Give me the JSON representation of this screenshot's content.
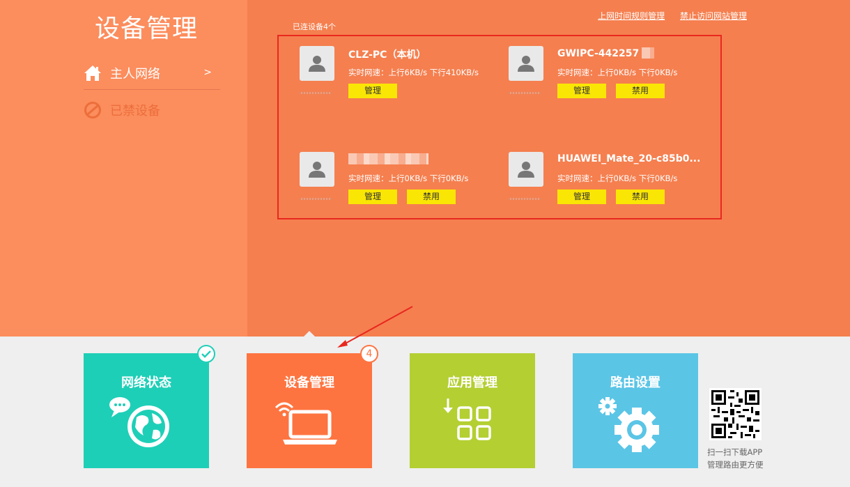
{
  "sidebar": {
    "title": "设备管理",
    "items": [
      {
        "label": "主人网络",
        "arrow": ">"
      },
      {
        "label": "已禁设备"
      }
    ]
  },
  "topbar": {
    "links": [
      "上网时间规则管理",
      "禁止访问网站管理"
    ]
  },
  "devices": {
    "count_label": "已连设备4个",
    "list": [
      {
        "name": "CLZ-PC（本机）",
        "speed": "实时网速：上行6KB/s 下行410KB/s",
        "buttons": [
          "管理"
        ]
      },
      {
        "name": "GWIPC-442257",
        "speed": "实时网速：上行0KB/s 下行0KB/s",
        "buttons": [
          "管理",
          "禁用"
        ]
      },
      {
        "name": "",
        "speed": "实时网速：上行0KB/s 下行0KB/s",
        "buttons": [
          "管理",
          "禁用"
        ]
      },
      {
        "name": "HUAWEI_Mate_20-c85b0...",
        "speed": "实时网速：上行0KB/s 下行0KB/s",
        "buttons": [
          "管理",
          "禁用"
        ]
      }
    ]
  },
  "tiles": [
    {
      "label": "网络状态",
      "color": "#1ecfb7",
      "icon": "globe-chat-icon",
      "badge": "check"
    },
    {
      "label": "设备管理",
      "color": "#fe7440",
      "icon": "laptop-wifi-icon",
      "badge": "4"
    },
    {
      "label": "应用管理",
      "color": "#b4cf32",
      "icon": "apps-grid-icon"
    },
    {
      "label": "路由设置",
      "color": "#5bc5e6",
      "icon": "gear-icon"
    }
  ],
  "qr": {
    "line1": "扫一扫下载APP",
    "line2": "管理路由更方便"
  }
}
